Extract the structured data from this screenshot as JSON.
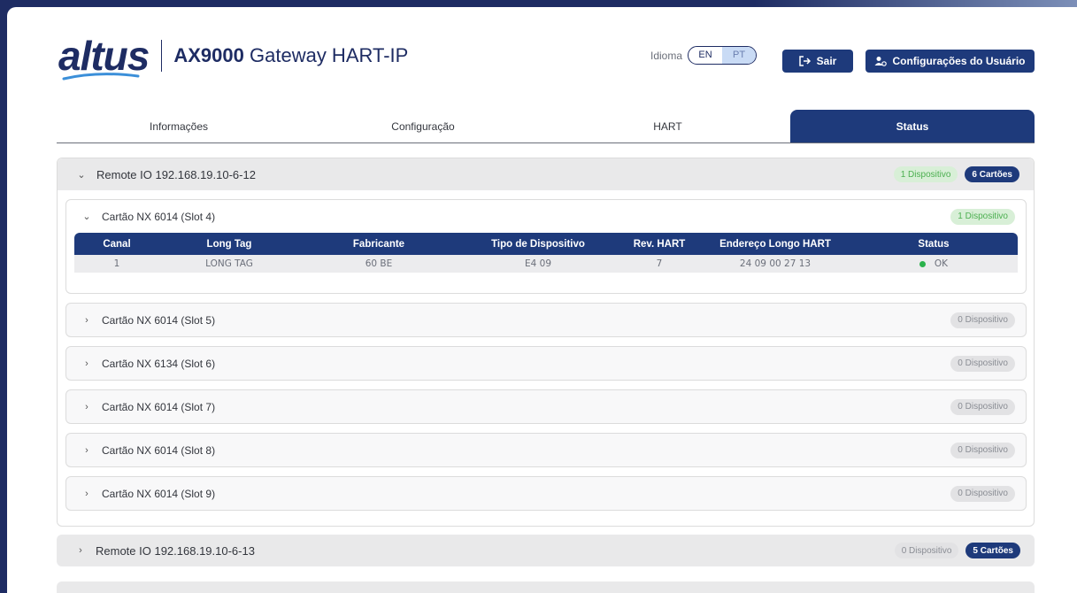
{
  "header": {
    "logo_text": "altus",
    "title_bold": "AX9000",
    "title_rest": " Gateway HART-IP",
    "language_label": "Idioma",
    "languages": [
      "EN",
      "PT"
    ],
    "selected_language": "PT",
    "logout_label": "Sair",
    "user_settings_label": "Configurações do Usuário"
  },
  "tabs": [
    {
      "label": "Informações",
      "active": false
    },
    {
      "label": "Configuração",
      "active": false
    },
    {
      "label": "HART",
      "active": false
    },
    {
      "label": "Status",
      "active": true
    }
  ],
  "remotes": [
    {
      "title": "Remote IO 192.168.19.10-6-12",
      "expanded": true,
      "devices_badge": "1 Dispositivo",
      "cards_badge": "6 Cartões",
      "cards": [
        {
          "title": "Cartão NX 6014 (Slot 4)",
          "expanded": true,
          "badge": "1 Dispositivo",
          "table": {
            "columns": [
              "Canal",
              "Long Tag",
              "Fabricante",
              "Tipo de Dispositivo",
              "Rev. HART",
              "Endereço Longo HART",
              "Status"
            ],
            "rows": [
              [
                "1",
                "LONG TAG",
                "60 BE",
                "E4 09",
                "7",
                "24 09 00 27 13",
                "OK"
              ]
            ]
          }
        },
        {
          "title": "Cartão NX 6014 (Slot 5)",
          "expanded": false,
          "badge": "0 Dispositivo"
        },
        {
          "title": "Cartão NX 6134 (Slot 6)",
          "expanded": false,
          "badge": "0 Dispositivo"
        },
        {
          "title": "Cartão NX 6014 (Slot 7)",
          "expanded": false,
          "badge": "0 Dispositivo"
        },
        {
          "title": "Cartão NX 6014 (Slot 8)",
          "expanded": false,
          "badge": "0 Dispositivo"
        },
        {
          "title": "Cartão NX 6014 (Slot 9)",
          "expanded": false,
          "badge": "0 Dispositivo"
        }
      ]
    },
    {
      "title": "Remote IO 192.168.19.10-6-13",
      "expanded": false,
      "devices_badge": "0 Dispositivo",
      "cards_badge": "5 Cartões"
    }
  ],
  "colors": {
    "brand_navy": "#1e3a7b",
    "status_ok": "#2bb24c",
    "badge_green_text": "#4caf50"
  },
  "icons": {
    "expanded": "chevron-down-icon",
    "collapsed": "chevron-right-icon",
    "logout": "logout-icon",
    "user_settings": "user-gear-icon",
    "status_ok": "status-dot-icon"
  }
}
